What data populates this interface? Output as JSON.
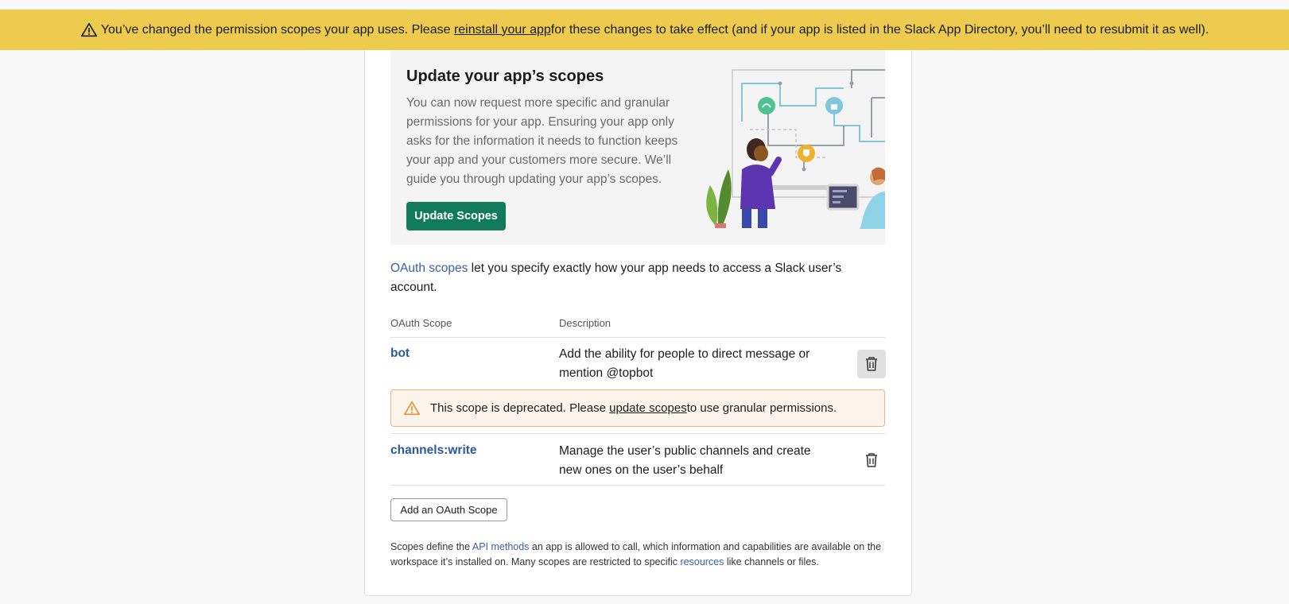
{
  "banner": {
    "before": "You’ve changed the permission scopes your app uses. Please ",
    "link": "reinstall your app",
    "after": " for these changes to take effect (and if your app is listed in the Slack App Directory, you’ll need to resubmit it as well)."
  },
  "promo": {
    "title": "Update your app’s scopes",
    "body": "You can now request more specific and granular permissions for your app. Ensuring your app only asks for the information it needs to function keeps your app and your customers more secure. We’ll guide you through updating your app’s scopes.",
    "button": "Update Scopes"
  },
  "intro": {
    "link": "OAuth scopes",
    "text": " let you specify exactly how your app needs to access a Slack user’s account."
  },
  "table": {
    "headers": {
      "scope": "OAuth Scope",
      "description": "Description"
    },
    "rows": [
      {
        "scope": "bot",
        "description": "Add the ability for people to direct message or mention @topbot"
      },
      {
        "scope": "channels:write",
        "description": "Manage the user’s public channels and create new ones on the user’s behalf"
      }
    ]
  },
  "deprecation": {
    "before": "This scope is deprecated. Please ",
    "link": "update scopes",
    "after": " to use granular permissions."
  },
  "add_button": "Add an OAuth Scope",
  "footnote": {
    "t1": "Scopes define the ",
    "link1": "API methods",
    "t2": " an app is allowed to call, which information and capabilities are available on the workspace it’s installed on. Many scopes are restricted to specific ",
    "link2": "resources",
    "t3": " like channels or files."
  },
  "colors": {
    "banner_bg": "#eccb4f",
    "primary_button": "#117a5b",
    "link": "#3b5ea6",
    "warning_border": "#f0b47a",
    "warning_icon": "#e8912d"
  },
  "icons": [
    "warning-icon",
    "trash-icon",
    "scopes-illustration"
  ]
}
